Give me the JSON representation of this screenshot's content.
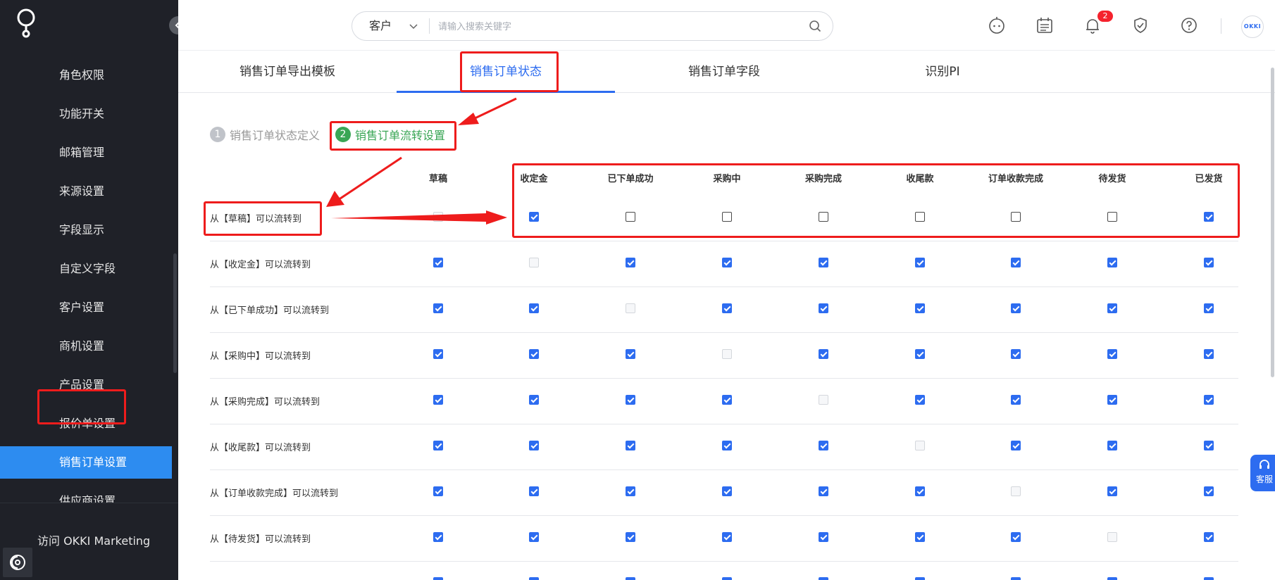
{
  "sidebar": {
    "items": [
      {
        "label": "角色权限",
        "active": false
      },
      {
        "label": "功能开关",
        "active": false
      },
      {
        "label": "邮箱管理",
        "active": false
      },
      {
        "label": "来源设置",
        "active": false
      },
      {
        "label": "字段显示",
        "active": false
      },
      {
        "label": "自定义字段",
        "active": false
      },
      {
        "label": "客户设置",
        "active": false
      },
      {
        "label": "商机设置",
        "active": false
      },
      {
        "label": "产品设置",
        "active": false
      },
      {
        "label": "报价单设置",
        "active": false
      },
      {
        "label": "销售订单设置",
        "active": true
      },
      {
        "label": "供应商设置",
        "active": false
      }
    ],
    "footer_link": "访问 OKKI Marketing"
  },
  "header": {
    "search_scope": "客户",
    "search_placeholder": "请输入搜索关键字",
    "notification_count": "2",
    "avatar_text": "OKKI"
  },
  "tabs": [
    {
      "label": "销售订单导出模板",
      "active": false
    },
    {
      "label": "销售订单状态",
      "active": true
    },
    {
      "label": "销售订单字段",
      "active": false
    },
    {
      "label": "识别PI",
      "active": false
    }
  ],
  "steps": [
    {
      "num": "1",
      "label": "销售订单状态定义",
      "active": false
    },
    {
      "num": "2",
      "label": "销售订单流转设置",
      "active": true
    }
  ],
  "transition_matrix": {
    "columns": [
      "草稿",
      "收定金",
      "已下单成功",
      "采购中",
      "采购完成",
      "收尾款",
      "订单收款完成",
      "待发货",
      "已发货"
    ],
    "rows": [
      {
        "label": "从【草稿】可以流转到",
        "cells": [
          "disabled",
          "checked",
          "unchecked",
          "unchecked",
          "unchecked",
          "unchecked",
          "unchecked",
          "unchecked",
          "checked"
        ]
      },
      {
        "label": "从【收定金】可以流转到",
        "cells": [
          "checked",
          "disabled",
          "checked",
          "checked",
          "checked",
          "checked",
          "checked",
          "checked",
          "checked"
        ]
      },
      {
        "label": "从【已下单成功】可以流转到",
        "cells": [
          "checked",
          "checked",
          "disabled",
          "checked",
          "checked",
          "checked",
          "checked",
          "checked",
          "checked"
        ]
      },
      {
        "label": "从【采购中】可以流转到",
        "cells": [
          "checked",
          "checked",
          "checked",
          "disabled",
          "checked",
          "checked",
          "checked",
          "checked",
          "checked"
        ]
      },
      {
        "label": "从【采购完成】可以流转到",
        "cells": [
          "checked",
          "checked",
          "checked",
          "checked",
          "disabled",
          "checked",
          "checked",
          "checked",
          "checked"
        ]
      },
      {
        "label": "从【收尾款】可以流转到",
        "cells": [
          "checked",
          "checked",
          "checked",
          "checked",
          "checked",
          "disabled",
          "checked",
          "checked",
          "checked"
        ]
      },
      {
        "label": "从【订单收款完成】可以流转到",
        "cells": [
          "checked",
          "checked",
          "checked",
          "checked",
          "checked",
          "checked",
          "disabled",
          "checked",
          "checked"
        ]
      },
      {
        "label": "从【待发货】可以流转到",
        "cells": [
          "checked",
          "checked",
          "checked",
          "checked",
          "checked",
          "checked",
          "checked",
          "disabled",
          "checked"
        ]
      }
    ]
  },
  "service_label": "客服",
  "colors": {
    "accent": "#2d6cf0",
    "sidebar_bg": "#1f2128",
    "sidebar_active": "#2d8cf0",
    "step_active": "#3aa655",
    "annotation": "#ee1c1c",
    "badge": "#f5222d"
  }
}
